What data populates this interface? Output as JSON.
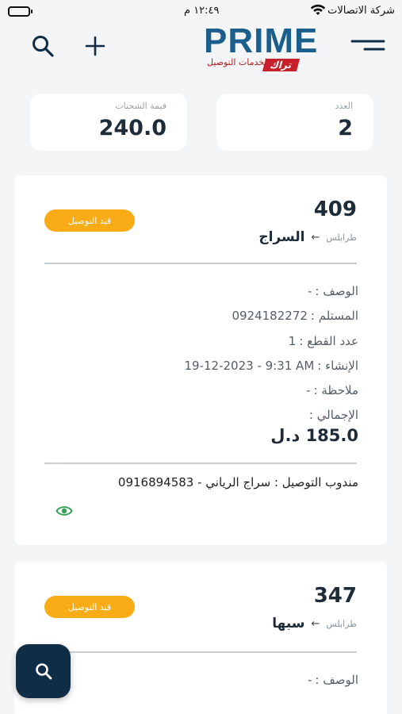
{
  "status_bar": {
    "carrier": "شركة الاتصالات",
    "time": "١٢:٤٩ م"
  },
  "header": {
    "logo_text": "PRIME",
    "logo_tagline": "لخدمات التوصيل",
    "logo_brand": "تراك"
  },
  "stats": {
    "count_label": "العدد",
    "count_value": "2",
    "value_label": "قيمة الشحنات",
    "value_value": "240.0"
  },
  "shipments": [
    {
      "id": "409",
      "status": "قيد التوصيل",
      "from": "طرابلس",
      "to": "السراج",
      "description_label": "الوصف :",
      "description_value": "-",
      "recipient_label": "المستلم :",
      "recipient_value": "0924182272",
      "pieces_label": "عدد القطع :",
      "pieces_value": "1",
      "created_label": "الإنشاء :",
      "created_value": "19-12-2023 - 9:31 AM",
      "note_label": "ملاحظة :",
      "note_value": "-",
      "total_label": "الإجمالي :",
      "total_value": "185.0 د.ل",
      "courier": "مندوب التوصيل : سراج الرياني - 0916894583"
    },
    {
      "id": "347",
      "status": "قيد التوصيل",
      "from": "طرابلس",
      "to": "سبها",
      "description_label": "الوصف :",
      "description_value": "-"
    }
  ],
  "colors": {
    "accent": "#f9ac16",
    "dark": "#0f2d44",
    "logo_blue": "#1d5f8c",
    "logo_red": "#c8202a",
    "eye": "#3aa35b"
  },
  "icons": [
    "search-icon",
    "plus-icon",
    "menu-icon",
    "wifi-icon",
    "battery-icon",
    "arrow-left-icon",
    "eye-icon"
  ]
}
